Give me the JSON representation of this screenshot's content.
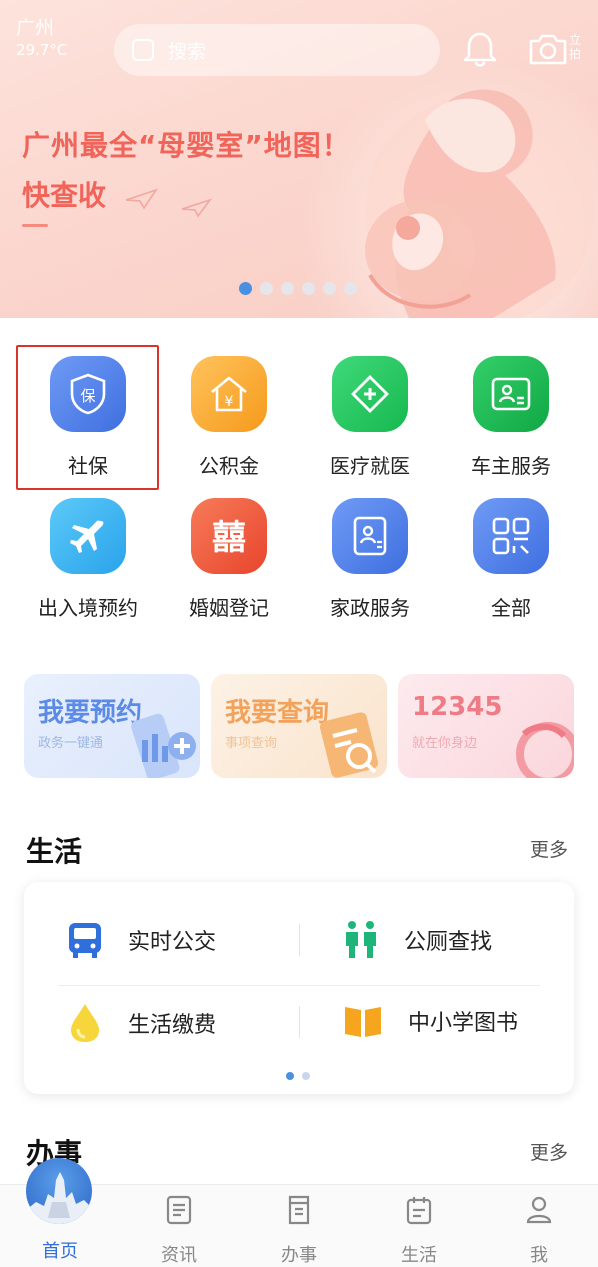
{
  "status": {
    "city": "广州",
    "temperature": "29.7°C"
  },
  "search": {
    "placeholder": "搜索"
  },
  "header_actions": {
    "bell_icon": "bell-icon",
    "camera_icon": "camera-icon",
    "instant_label": "立拍"
  },
  "banner": {
    "headline_line1": "广州最全“母婴室”地图！",
    "headline_line2": "快查收",
    "slide_count": 6,
    "active_slide": 1
  },
  "services": [
    {
      "label": "社保",
      "icon": "shield-icon",
      "color": "#4a7ff0",
      "highlighted": true
    },
    {
      "label": "公积金",
      "icon": "house-yen-icon",
      "color": "#f6a623"
    },
    {
      "label": "医疗就医",
      "icon": "medical-diamond-icon",
      "color": "#23c45e"
    },
    {
      "label": "车主服务",
      "icon": "id-card-icon",
      "color": "#1db954"
    },
    {
      "label": "出入境预约",
      "icon": "airplane-icon",
      "color": "#3ab1f0"
    },
    {
      "label": "婚姻登记",
      "icon": "double-happiness-icon",
      "color": "#ef5a3c"
    },
    {
      "label": "家政服务",
      "icon": "id-card-icon",
      "color": "#4a7ff0"
    },
    {
      "label": "全部",
      "icon": "grid-icon",
      "color": "#4a7ff0"
    }
  ],
  "shortcuts": [
    {
      "title": "我要预约",
      "subtitle": "政务一键通",
      "color": "#5b8be6",
      "bg": "#e6eefc"
    },
    {
      "title": "我要查询",
      "subtitle": "事项查询",
      "color": "#f2a25a",
      "bg": "#fcefe2"
    },
    {
      "title": "12345",
      "subtitle": "就在你身边",
      "color": "#ee7b86",
      "bg": "#fde7ea"
    }
  ],
  "life": {
    "title": "生活",
    "more": "更多",
    "items": [
      {
        "label": "实时公交",
        "icon": "bus-icon"
      },
      {
        "label": "公厕查找",
        "icon": "restroom-icon"
      },
      {
        "label": "生活缴费",
        "icon": "water-drop-icon"
      },
      {
        "label": "中小学图书",
        "icon": "book-icon"
      }
    ],
    "page_count": 2,
    "active_page": 1
  },
  "banshi": {
    "title": "办事",
    "more": "更多"
  },
  "nav": [
    {
      "label": "首页",
      "icon": "home-icon",
      "active": true
    },
    {
      "label": "资讯",
      "icon": "news-icon"
    },
    {
      "label": "办事",
      "icon": "tasks-icon"
    },
    {
      "label": "生活",
      "icon": "calendar-icon"
    },
    {
      "label": "我",
      "icon": "user-icon"
    }
  ],
  "colors": {
    "accent": "#2f6fdc",
    "banner_text": "#f0645a",
    "highlight_border": "#d9342b"
  }
}
